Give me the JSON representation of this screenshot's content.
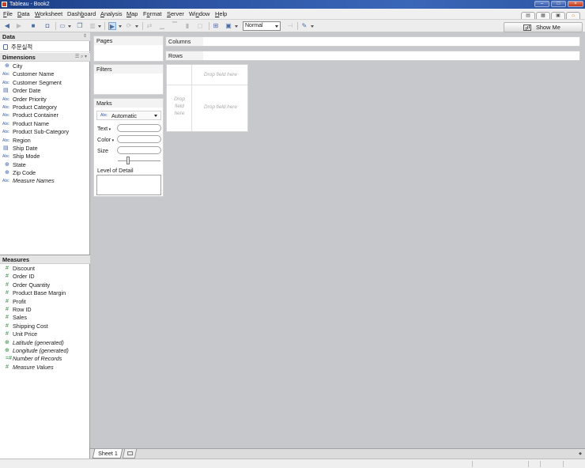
{
  "window": {
    "title": "Tableau - Book2",
    "minimize_label": "–",
    "maximize_label": "□",
    "close_label": "×"
  },
  "menu": [
    {
      "label_acc": "F",
      "label_rest": "ile"
    },
    {
      "label_acc": "D",
      "label_rest": "ata"
    },
    {
      "label_acc": "W",
      "label_rest": "orksheet"
    },
    {
      "label_pre": "Dash",
      "label_acc": "b",
      "label_rest": "oard"
    },
    {
      "label_acc": "A",
      "label_rest": "nalysis"
    },
    {
      "label_acc": "M",
      "label_rest": "ap"
    },
    {
      "label_pre": "F",
      "label_acc": "o",
      "label_rest": "rmat"
    },
    {
      "label_acc": "S",
      "label_rest": "erver"
    },
    {
      "label_pre": "Wi",
      "label_acc": "n",
      "label_rest": "dow"
    },
    {
      "label_acc": "H",
      "label_rest": "elp"
    }
  ],
  "toolbar": {
    "fit_select_value": "Normal"
  },
  "show_me": {
    "label": "Show Me"
  },
  "data_pane": {
    "title": "Data",
    "datasource": "주문실적",
    "dimensions_title": "Dimensions",
    "dimensions": [
      {
        "type": "geo",
        "type_label": "⊕",
        "name": "City"
      },
      {
        "type": "abc",
        "type_label": "Abc",
        "name": "Customer Name"
      },
      {
        "type": "abc",
        "type_label": "Abc",
        "name": "Customer Segment"
      },
      {
        "type": "date",
        "type_label": "▤",
        "name": "Order Date"
      },
      {
        "type": "abc",
        "type_label": "Abc",
        "name": "Order Priority"
      },
      {
        "type": "abc",
        "type_label": "Abc",
        "name": "Product Category"
      },
      {
        "type": "abc",
        "type_label": "Abc",
        "name": "Product Container"
      },
      {
        "type": "abc",
        "type_label": "Abc",
        "name": "Product Name"
      },
      {
        "type": "abc",
        "type_label": "Abc",
        "name": "Product Sub-Category"
      },
      {
        "type": "abc",
        "type_label": "Abc",
        "name": "Region"
      },
      {
        "type": "date",
        "type_label": "▤",
        "name": "Ship Date"
      },
      {
        "type": "abc",
        "type_label": "Abc",
        "name": "Ship Mode"
      },
      {
        "type": "geo",
        "type_label": "⊕",
        "name": "State"
      },
      {
        "type": "geo",
        "type_label": "⊕",
        "name": "Zip Code"
      },
      {
        "type": "abc",
        "type_label": "Abc",
        "name": "Measure Names",
        "italic": true
      }
    ],
    "measures_title": "Measures",
    "measures": [
      {
        "type": "num",
        "type_label": "#",
        "name": "Discount"
      },
      {
        "type": "num",
        "type_label": "#",
        "name": "Order ID"
      },
      {
        "type": "num",
        "type_label": "#",
        "name": "Order Quantity"
      },
      {
        "type": "num",
        "type_label": "#",
        "name": "Product Base Margin"
      },
      {
        "type": "num",
        "type_label": "#",
        "name": "Profit"
      },
      {
        "type": "num",
        "type_label": "#",
        "name": "Row ID"
      },
      {
        "type": "num",
        "type_label": "#",
        "name": "Sales"
      },
      {
        "type": "num",
        "type_label": "#",
        "name": "Shipping Cost"
      },
      {
        "type": "num",
        "type_label": "#",
        "name": "Unit Price"
      },
      {
        "type": "geo-num",
        "type_label": "⊕",
        "name": "Latitude (generated)",
        "italic": true
      },
      {
        "type": "geo-num",
        "type_label": "⊕",
        "name": "Longitude (generated)",
        "italic": true
      },
      {
        "type": "num",
        "type_label": "=#",
        "name": "Number of Records",
        "italic": true
      },
      {
        "type": "num",
        "type_label": "#",
        "name": "Measure Values",
        "italic": true
      }
    ]
  },
  "cards": {
    "pages": "Pages",
    "filters": "Filters",
    "marks": "Marks",
    "mark_type_icon": "Abc",
    "mark_type": "Automatic",
    "text": "Text",
    "color": "Color",
    "size": "Size",
    "level_of_detail": "Level of Detail"
  },
  "shelves": {
    "columns": "Columns",
    "rows": "Rows"
  },
  "view": {
    "drop_top": "Drop field here",
    "drop_left": "Drop field here",
    "drop_center": "Drop field here"
  },
  "tabs": {
    "sheet1": "Sheet 1"
  }
}
